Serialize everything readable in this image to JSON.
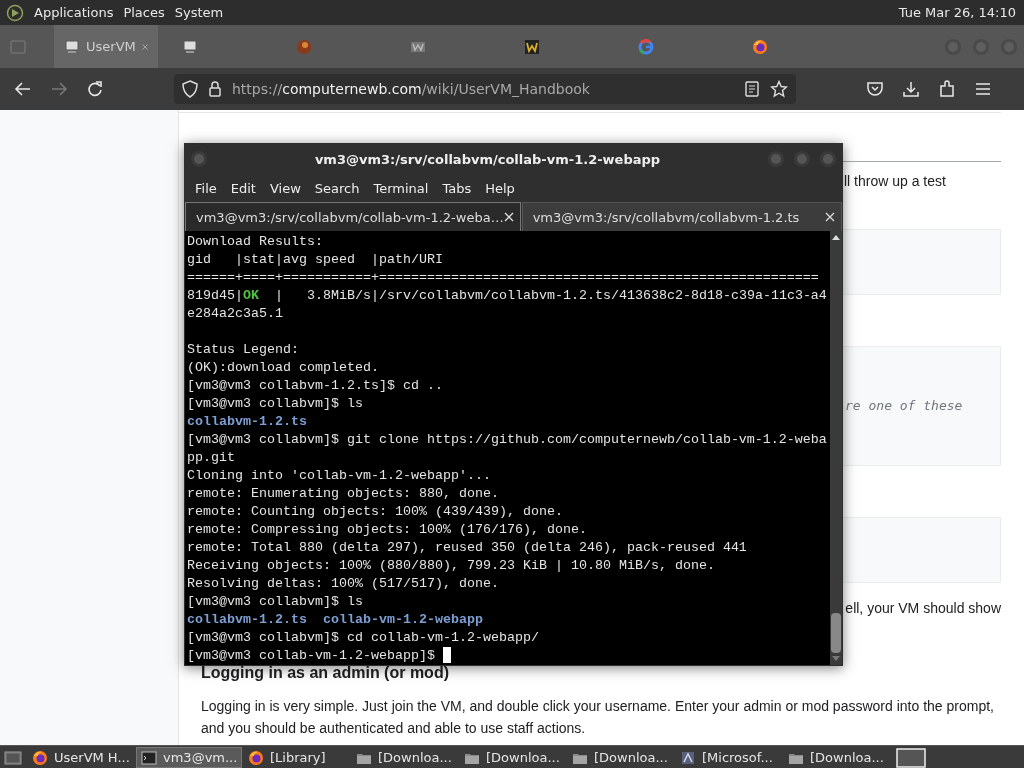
{
  "top_panel": {
    "menus": [
      "Applications",
      "Places",
      "System"
    ],
    "clock": "Tue Mar 26, 14:10"
  },
  "browser": {
    "tabs": [
      {
        "kind": "computer",
        "label": "UserVM",
        "selected": true
      },
      {
        "kind": "computer",
        "selected": false
      },
      {
        "kind": "round",
        "selected": false
      },
      {
        "kind": "wiki",
        "selected": false
      },
      {
        "kind": "wsquare",
        "selected": false
      },
      {
        "kind": "google",
        "selected": false
      },
      {
        "kind": "firefox",
        "selected": false
      }
    ],
    "nav": {
      "back_disabled": false,
      "forward_disabled": true
    },
    "url": {
      "scheme": "https://",
      "host": "computernewb.com",
      "path": "/wiki/UserVM_Handbook"
    }
  },
  "page": {
    "text_1": "ll throw up a test",
    "code_text": "re one of these",
    "text_2": "ell, your VM should show",
    "heading_2": "Logging in as an admin (or mod)",
    "paragraph": "Logging in is very simple. Just join the VM, and double click your username. Enter your admin or mod password into the prompt, and you should be authenticated and able to use staff actions."
  },
  "terminal": {
    "title": "vm3@vm3:/srv/collabvm/collab-vm-1.2-webapp",
    "menus": [
      "File",
      "Edit",
      "View",
      "Search",
      "Terminal",
      "Tabs",
      "Help"
    ],
    "tabs": [
      {
        "label": "vm3@vm3:/srv/collabvm/collab-vm-1.2-weba…",
        "selected": true
      },
      {
        "label": "vm3@vm3:/srv/collabvm/collabvm-1.2.ts",
        "selected": false
      }
    ],
    "lines": [
      [
        {
          "text": "Download Results:",
          "kind": "plain"
        }
      ],
      [
        {
          "text": "gid   |stat|avg speed  |path/URI",
          "kind": "plain"
        }
      ],
      [
        {
          "text": "======+====+===========+=======================================================",
          "kind": "plain"
        }
      ],
      [
        {
          "text": "819d45|",
          "kind": "plain"
        },
        {
          "text": "OK",
          "kind": "ok"
        },
        {
          "text": "  |   3.8MiB/s|/srv/collabvm/collabvm-1.2.ts/413638c2-8d18-c39a-11c3-a4",
          "kind": "plain"
        }
      ],
      [
        {
          "text": "e284a2c3a5.1",
          "kind": "plain"
        }
      ],
      [
        {
          "kind": "blank"
        }
      ],
      [
        {
          "text": "Status Legend:",
          "kind": "plain"
        }
      ],
      [
        {
          "text": "(OK):download completed.",
          "kind": "plain"
        }
      ],
      [
        {
          "text": "[vm3@vm3 collabvm-1.2.ts]$ cd ..",
          "kind": "plain"
        }
      ],
      [
        {
          "text": "[vm3@vm3 collabvm]$ ls",
          "kind": "plain"
        }
      ],
      [
        {
          "text": "collabvm-1.2.ts",
          "kind": "dir"
        }
      ],
      [
        {
          "text": "[vm3@vm3 collabvm]$ git clone https://github.com/computernewb/collab-vm-1.2-weba",
          "kind": "plain"
        }
      ],
      [
        {
          "text": "pp.git",
          "kind": "plain"
        }
      ],
      [
        {
          "text": "Cloning into 'collab-vm-1.2-webapp'...",
          "kind": "plain"
        }
      ],
      [
        {
          "text": "remote: Enumerating objects: 880, done.",
          "kind": "plain"
        }
      ],
      [
        {
          "text": "remote: Counting objects: 100% (439/439), done.",
          "kind": "plain"
        }
      ],
      [
        {
          "text": "remote: Compressing objects: 100% (176/176), done.",
          "kind": "plain"
        }
      ],
      [
        {
          "text": "remote: Total 880 (delta 297), reused 350 (delta 246), pack-reused 441",
          "kind": "plain"
        }
      ],
      [
        {
          "text": "Receiving objects: 100% (880/880), 799.23 KiB | 10.80 MiB/s, done.",
          "kind": "plain"
        }
      ],
      [
        {
          "text": "Resolving deltas: 100% (517/517), done.",
          "kind": "plain"
        }
      ],
      [
        {
          "text": "[vm3@vm3 collabvm]$ ls",
          "kind": "plain"
        }
      ],
      [
        {
          "text": "collabvm-1.2.ts  collab-vm-1.2-webapp",
          "kind": "dir"
        }
      ],
      [
        {
          "text": "[vm3@vm3 collabvm]$ cd collab-vm-1.2-webapp/",
          "kind": "plain"
        }
      ],
      [
        {
          "text": "[vm3@vm3 collab-vm-1.2-webapp]$ ",
          "kind": "plain"
        }
      ]
    ],
    "cursor": true
  },
  "taskbar": {
    "items": [
      {
        "kind": "firefox",
        "label": "UserVM H...",
        "selected": false
      },
      {
        "kind": "terminal",
        "label": "vm3@vm...",
        "selected": true
      },
      {
        "kind": "firefox",
        "label": "[Library]",
        "selected": false
      },
      {
        "kind": "folder",
        "label": "[Downloa...",
        "selected": false
      },
      {
        "kind": "folder",
        "label": "[Downloa...",
        "selected": false
      },
      {
        "kind": "folder",
        "label": "[Downloa...",
        "selected": false
      },
      {
        "kind": "app",
        "label": "[Microsof...",
        "selected": false
      },
      {
        "kind": "folder",
        "label": "[Downloa...",
        "selected": false
      }
    ]
  }
}
